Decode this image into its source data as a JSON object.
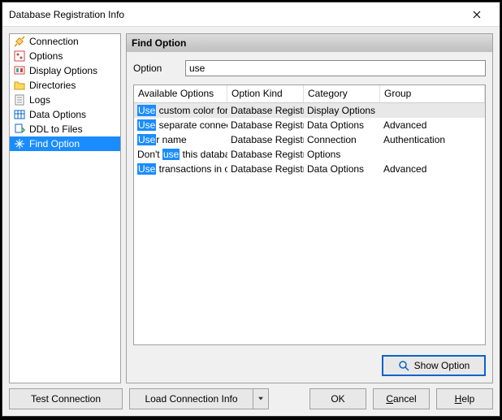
{
  "window": {
    "title": "Database Registration Info"
  },
  "sidebar": {
    "items": [
      {
        "label": "Connection"
      },
      {
        "label": "Options"
      },
      {
        "label": "Display Options"
      },
      {
        "label": "Directories"
      },
      {
        "label": "Logs"
      },
      {
        "label": "Data Options"
      },
      {
        "label": "DDL to Files"
      },
      {
        "label": "Find Option"
      }
    ]
  },
  "content": {
    "title": "Find Option",
    "option_label": "Option",
    "option_value": "use"
  },
  "table": {
    "headers": {
      "available": "Available Options",
      "kind": "Option Kind",
      "category": "Category",
      "group": "Group"
    },
    "rows": [
      {
        "pre": "",
        "hl": "Use",
        "post": " custom color for DB editors",
        "kind": "Database Registration",
        "category": "Display Options",
        "group": ""
      },
      {
        "pre": "",
        "hl": "Use",
        "post": " separate connections for each data view",
        "kind": "Database Registration",
        "category": "Data Options",
        "group": "Advanced"
      },
      {
        "pre": "",
        "hl": "Use",
        "post": "r name",
        "kind": "Database Registration",
        "category": "Connection",
        "group": "Authentication"
      },
      {
        "pre": "Don't ",
        "hl": "use",
        "post": " this database registration",
        "kind": "Database Registration",
        "category": "Options",
        "group": ""
      },
      {
        "pre": "",
        "hl": "Use",
        "post": " transactions in object editors",
        "kind": "Database Registration",
        "category": "Data Options",
        "group": "Advanced"
      }
    ]
  },
  "buttons": {
    "show_option": "Show Option",
    "test_connection": "Test Connection",
    "load_connection": "Load Connection Info",
    "ok": "OK",
    "cancel": "Cancel",
    "help": "Help"
  }
}
